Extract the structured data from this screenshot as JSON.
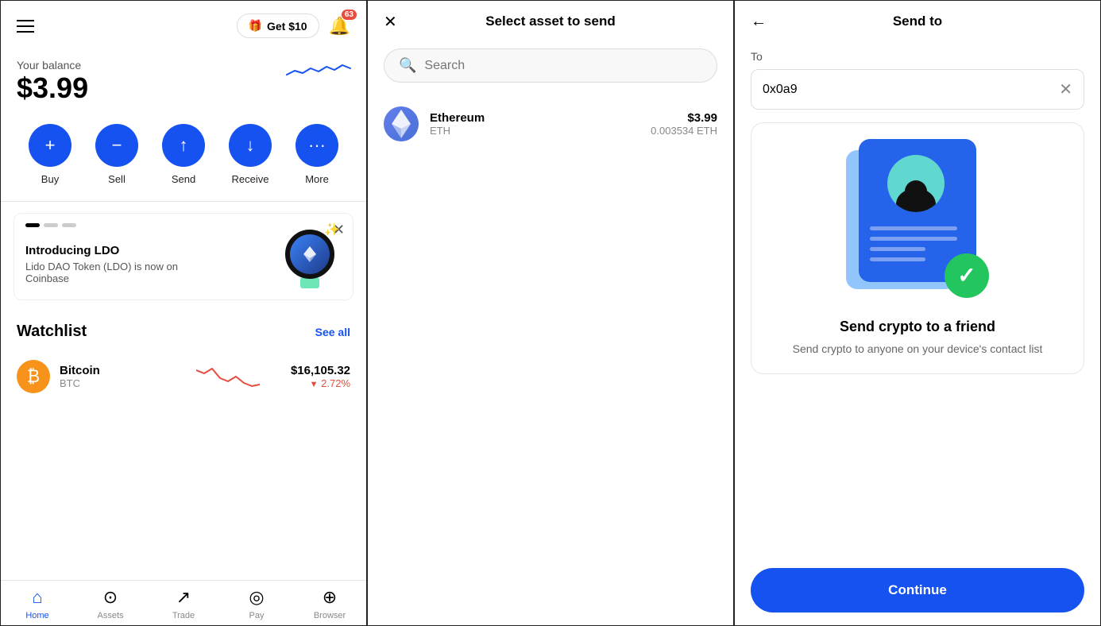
{
  "panel1": {
    "header": {
      "get_label": "Get $10",
      "notif_count": "63"
    },
    "balance": {
      "label": "Your balance",
      "amount": "$3.99"
    },
    "actions": [
      {
        "label": "Buy",
        "icon": "+"
      },
      {
        "label": "Sell",
        "icon": "−"
      },
      {
        "label": "Send",
        "icon": "↑"
      },
      {
        "label": "Receive",
        "icon": "↓"
      },
      {
        "label": "More",
        "icon": "···"
      }
    ],
    "promo": {
      "title": "Introducing LDO",
      "description": "Lido DAO Token (LDO) is now on Coinbase"
    },
    "watchlist": {
      "title": "Watchlist",
      "see_all": "See all",
      "coins": [
        {
          "name": "Bitcoin",
          "ticker": "BTC",
          "price": "$16,105.32",
          "change": "▼ 2.72%",
          "icon": "₿"
        }
      ]
    },
    "nav": [
      {
        "label": "Home",
        "active": true
      },
      {
        "label": "Assets",
        "active": false
      },
      {
        "label": "Trade",
        "active": false
      },
      {
        "label": "Pay",
        "active": false
      },
      {
        "label": "Browser",
        "active": false
      }
    ]
  },
  "panel2": {
    "title": "Select asset to send",
    "search_placeholder": "Search",
    "assets": [
      {
        "name": "Ethereum",
        "ticker": "ETH",
        "usd_value": "$3.99",
        "crypto_value": "0.003534 ETH"
      }
    ]
  },
  "panel3": {
    "title": "Send to",
    "to_label": "To",
    "address_value": "0x0a9",
    "card": {
      "title": "Send crypto to a friend",
      "description": "Send crypto to anyone on your device's contact list"
    },
    "continue_label": "Continue"
  }
}
